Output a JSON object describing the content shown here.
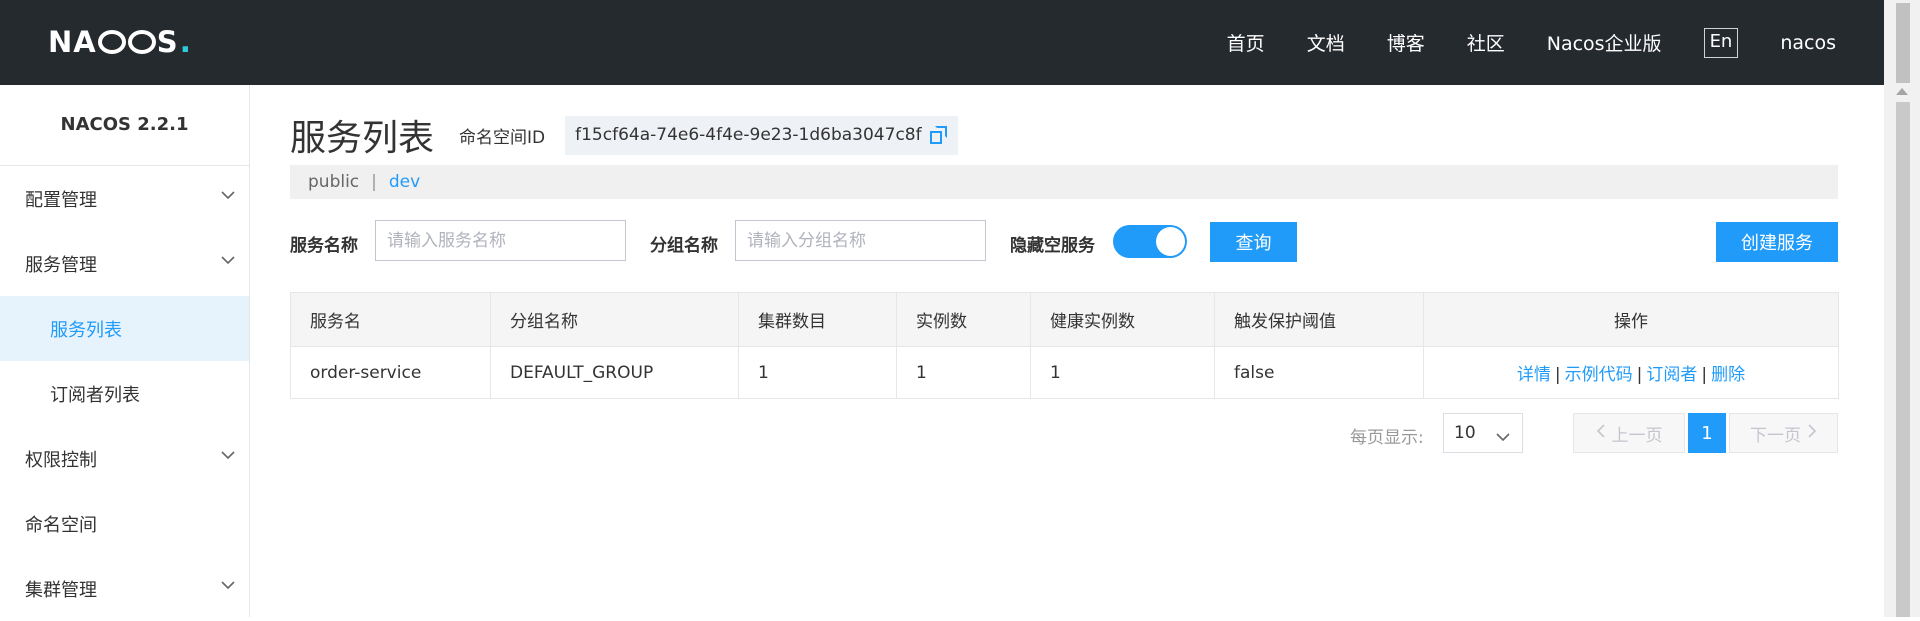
{
  "header": {
    "logo": "NACOS.",
    "nav": [
      "首页",
      "文档",
      "博客",
      "社区",
      "Nacos企业版"
    ],
    "lang_button": "En",
    "user": "nacos"
  },
  "sidebar": {
    "version": "NACOS 2.2.1",
    "items": [
      {
        "label": "配置管理",
        "expandable": true
      },
      {
        "label": "服务管理",
        "expandable": true
      },
      {
        "label": "服务列表",
        "sub": true,
        "active": true
      },
      {
        "label": "订阅者列表",
        "sub": true
      },
      {
        "label": "权限控制",
        "expandable": true
      },
      {
        "label": "命名空间"
      },
      {
        "label": "集群管理",
        "expandable": true
      }
    ]
  },
  "main": {
    "title": "服务列表",
    "namespace_label": "命名空间ID",
    "namespace_id": "f15cf64a-74e6-4f4e-9e23-1d6ba3047c8f",
    "namespaces": [
      "public",
      "dev"
    ],
    "active_namespace": "dev",
    "filters": {
      "service_name_label": "服务名称",
      "service_name_placeholder": "请输入服务名称",
      "group_name_label": "分组名称",
      "group_name_placeholder": "请输入分组名称",
      "hide_empty_label": "隐藏空服务",
      "hide_empty_enabled": true,
      "query_button": "查询",
      "create_button": "创建服务"
    },
    "table": {
      "columns": [
        "服务名",
        "分组名称",
        "集群数目",
        "实例数",
        "健康实例数",
        "触发保护阈值",
        "操作"
      ],
      "rows": [
        {
          "service": "order-service",
          "group": "DEFAULT_GROUP",
          "clusters": "1",
          "instances": "1",
          "healthy": "1",
          "protect": "false",
          "ops": [
            "详情",
            "示例代码",
            "订阅者",
            "删除"
          ]
        }
      ]
    },
    "pagination": {
      "page_size_label": "每页显示:",
      "page_size": "10",
      "prev": "上一页",
      "current": "1",
      "next": "下一页"
    }
  },
  "colors": {
    "header_bg": "#252a2f",
    "primary": "#209bfa",
    "active_menu_bg": "#e6f3fd"
  }
}
